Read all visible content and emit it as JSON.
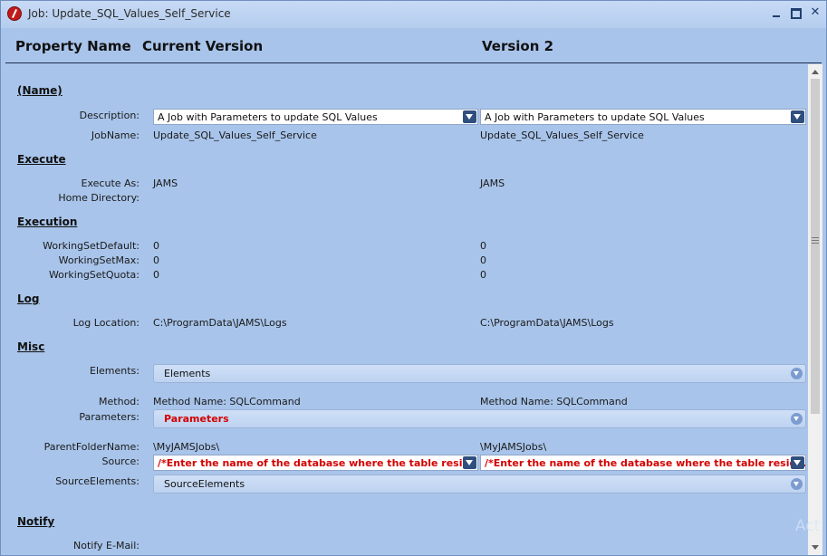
{
  "window": {
    "title": "Job: Update_SQL_Values_Self_Service",
    "controls": {
      "minimize": "",
      "maximize": "",
      "close": "✕"
    }
  },
  "header": {
    "property_name": "Property Name",
    "current_version": "Current Version",
    "version2": "Version 2"
  },
  "sections": {
    "name": "(Name)",
    "execute": "Execute",
    "execution": "Execution",
    "log": "Log",
    "misc": "Misc",
    "notify": "Notify"
  },
  "labels": {
    "description": "Description:",
    "jobname": "JobName:",
    "execute_as": "Execute As:",
    "home_directory": "Home Directory:",
    "ws_default": "WorkingSetDefault:",
    "ws_max": "WorkingSetMax:",
    "ws_quota": "WorkingSetQuota:",
    "log_location": "Log Location:",
    "elements": "Elements:",
    "method": "Method:",
    "parameters": "Parameters:",
    "parent_folder": "ParentFolderName:",
    "source": "Source:",
    "source_elements": "SourceElements:",
    "notify_email": "Notify E-Mail:"
  },
  "current": {
    "description": "A Job with Parameters to update SQL Values",
    "jobname": "Update_SQL_Values_Self_Service",
    "execute_as": "JAMS",
    "ws_default": "0",
    "ws_max": "0",
    "ws_quota": "0",
    "log_location": "C:\\ProgramData\\JAMS\\Logs",
    "method": "Method Name: SQLCommand",
    "parent_folder": "\\MyJAMSJobs\\",
    "source": "/*Enter the name of the database where the table reside..."
  },
  "version2": {
    "description": "A Job with Parameters to update SQL Values",
    "jobname": "Update_SQL_Values_Self_Service",
    "execute_as": "JAMS",
    "ws_default": "0",
    "ws_max": "0",
    "ws_quota": "0",
    "log_location": "C:\\ProgramData\\JAMS\\Logs",
    "method": "Method Name: SQLCommand",
    "parent_folder": "\\MyJAMSJobs\\",
    "source": "/*Enter the name of the database where the table reside..."
  },
  "expanders": {
    "elements": "Elements",
    "parameters": "Parameters",
    "source_elements": "SourceElements"
  },
  "watermark": "Act",
  "colors": {
    "background": "#a8c4ea",
    "highlight_text": "#d40000",
    "dropdown_button": "#2f4f7f"
  }
}
